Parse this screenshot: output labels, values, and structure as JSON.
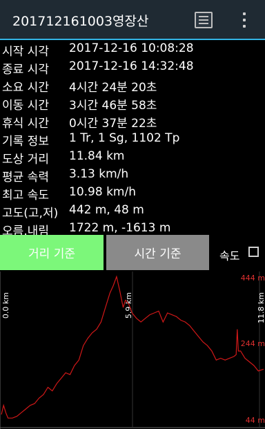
{
  "appbar": {
    "title": "201712161003영장산",
    "list_icon": "list-icon",
    "more_icon": "overflow-menu-icon"
  },
  "info": [
    {
      "key": "시작 시각",
      "value": "2017-12-16 10:08:28"
    },
    {
      "key": "종료 시각",
      "value": "2017-12-16 14:32:48"
    },
    {
      "key": "소요 시간",
      "value": "4시간 24분 20초"
    },
    {
      "key": "이동 시간",
      "value": "3시간 46분 58초"
    },
    {
      "key": "휴식 시간",
      "value": "0시간 37분 22초"
    },
    {
      "key": "기록 정보",
      "value": "1 Tr, 1 Sg, 1102 Tp"
    },
    {
      "key": "도상 거리",
      "value": "11.84 km"
    },
    {
      "key": "평균 속력",
      "value": "3.13 km/h"
    },
    {
      "key": "최고 속도",
      "value": "10.98 km/h"
    },
    {
      "key": "고도(고,저)",
      "value": "442 m, 48 m"
    },
    {
      "key": "오름,내림",
      "value": "1722 m, -1613 m"
    }
  ],
  "buttons": {
    "distance": "거리 기준",
    "time": "시간 기준"
  },
  "speed_toggle": {
    "label": "속도",
    "checked": false
  },
  "colors": {
    "appbar": "#1f2a33",
    "accent": "#33b5e5",
    "active_button": "#7cf77a",
    "inactive_button": "#8a8a8a",
    "line": "#d01818",
    "elevation_label": "#e03030"
  },
  "chart_data": {
    "type": "line",
    "title": "",
    "xlabel": "",
    "ylabel": "",
    "x_ticks": [
      "0.0 km",
      "5.9 km",
      "11.8 km"
    ],
    "y_ticks": [
      "444 m",
      "244 m",
      "44 m"
    ],
    "xlim": [
      0,
      11.84
    ],
    "ylim": [
      44,
      444
    ],
    "grid": false,
    "series": [
      {
        "name": "",
        "x": [
          0.0,
          0.1,
          0.2,
          0.3,
          0.5,
          0.7,
          0.9,
          1.1,
          1.3,
          1.5,
          1.7,
          1.9,
          2.1,
          2.3,
          2.5,
          2.7,
          2.9,
          3.1,
          3.3,
          3.5,
          3.7,
          3.9,
          4.1,
          4.3,
          4.5,
          4.7,
          4.9,
          5.05,
          5.2,
          5.35,
          5.5,
          5.6,
          5.75,
          5.9,
          6.1,
          6.3,
          6.5,
          6.7,
          6.9,
          7.1,
          7.3,
          7.5,
          7.7,
          7.9,
          8.1,
          8.3,
          8.5,
          8.7,
          8.9,
          9.1,
          9.3,
          9.5,
          9.7,
          9.9,
          10.1,
          10.3,
          10.5,
          10.6,
          10.65,
          10.7,
          10.8,
          10.9,
          11.0,
          11.2,
          11.4,
          11.6,
          11.84
        ],
        "y": [
          65,
          90,
          70,
          55,
          55,
          60,
          70,
          80,
          90,
          95,
          110,
          120,
          140,
          130,
          150,
          165,
          180,
          175,
          200,
          215,
          255,
          275,
          290,
          300,
          320,
          360,
          400,
          420,
          445,
          405,
          360,
          380,
          370,
          345,
          330,
          320,
          330,
          340,
          345,
          350,
          320,
          345,
          340,
          335,
          325,
          320,
          310,
          295,
          280,
          265,
          255,
          240,
          215,
          220,
          215,
          220,
          225,
          230,
          300,
          240,
          240,
          230,
          220,
          210,
          200,
          185,
          190
        ]
      }
    ]
  }
}
